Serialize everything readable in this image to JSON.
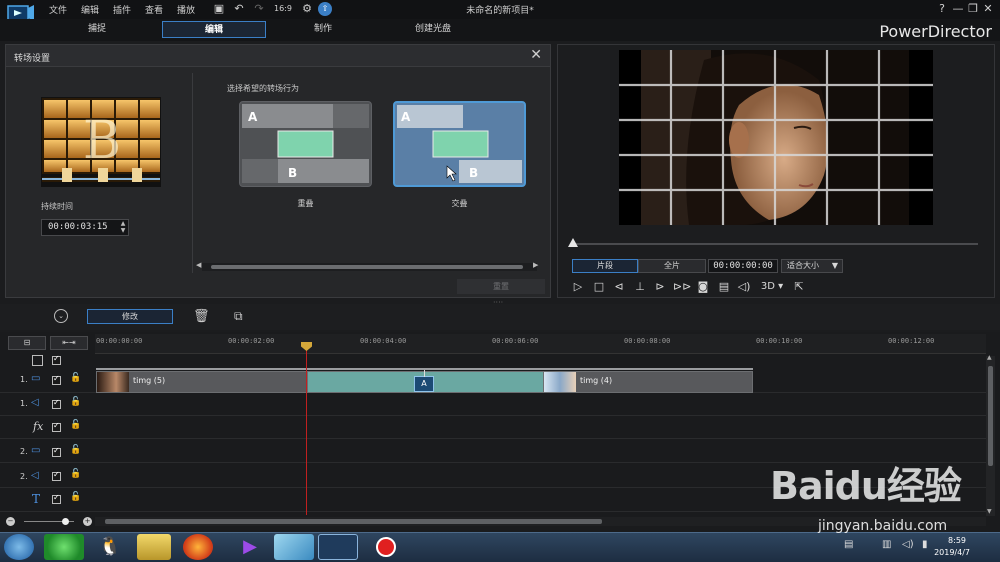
{
  "window": {
    "title": "未命名的新项目*",
    "brand": "PowerDirector",
    "controls": [
      "?",
      "—",
      "❐",
      "✕"
    ]
  },
  "menu": [
    "文件",
    "编辑",
    "插件",
    "查看",
    "播放"
  ],
  "mode_tabs": [
    {
      "label": "捕捉",
      "active": false
    },
    {
      "label": "编辑",
      "active": true
    },
    {
      "label": "制作",
      "active": false
    },
    {
      "label": "创建光盘",
      "active": false
    }
  ],
  "transition_panel": {
    "title": "转场设置",
    "thumbnail_letter": "B",
    "duration_label": "持续时间",
    "duration_value": "00:00:03:15",
    "behavior_label": "选择希望的转场行为",
    "options": [
      {
        "label": "重叠",
        "selected": false
      },
      {
        "label": "交叠",
        "selected": true
      }
    ],
    "card_letters": {
      "a": "A",
      "b": "B"
    },
    "reset_label": "重置"
  },
  "preview": {
    "clip_btn": "片段",
    "full_btn": "全片",
    "timecode": "00:00:00:00",
    "fit_select": "适合大小",
    "threed": "3D"
  },
  "edit_toolbar": {
    "modify": "修改"
  },
  "timeline": {
    "ruler_ticks": [
      "00:00:00:00",
      "00:00:02:00",
      "00:00:04:00",
      "00:00:06:00",
      "00:00:08:00",
      "00:00:10:00",
      "00:00:12:00"
    ],
    "tracks": [
      {
        "num": "1.",
        "icon": "video-track-icon"
      },
      {
        "num": "1.",
        "icon": "audio-track-icon"
      },
      {
        "num": "",
        "icon": "fx-track-icon"
      },
      {
        "num": "2.",
        "icon": "video-track-icon"
      },
      {
        "num": "2.",
        "icon": "audio-track-icon"
      },
      {
        "num": "",
        "icon": "title-track-icon"
      }
    ],
    "clips": [
      {
        "label": "timg (5)"
      },
      {
        "label": "timg (4)"
      }
    ]
  },
  "taskbar": {
    "time": "8:59",
    "date": "2019/4/7"
  },
  "watermark": {
    "text": "Baidu经验",
    "url": "jingyan.baidu.com"
  },
  "colors": {
    "accent": "#3b7fc6",
    "transition_clip": "#6aa8a2",
    "playhead": "#c02020"
  }
}
